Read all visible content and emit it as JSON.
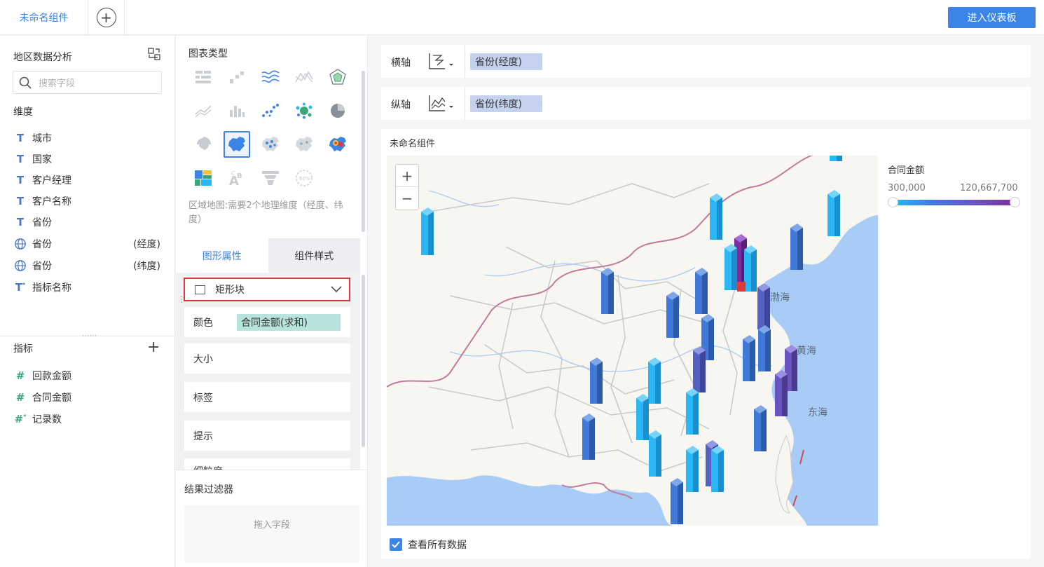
{
  "tabs": {
    "active_tab": "未命名组件",
    "add_label": "+"
  },
  "header": {
    "enter_dashboard": "进入仪表板"
  },
  "left_panel": {
    "title": "地区数据分析",
    "search_placeholder": "搜索字段",
    "dimensions_title": "维度",
    "dimensions": [
      {
        "icon": "T",
        "name": "城市",
        "suffix": ""
      },
      {
        "icon": "T",
        "name": "国家",
        "suffix": ""
      },
      {
        "icon": "T",
        "name": "客户经理",
        "suffix": ""
      },
      {
        "icon": "T",
        "name": "客户名称",
        "suffix": ""
      },
      {
        "icon": "T",
        "name": "省份",
        "suffix": ""
      },
      {
        "icon": "globe",
        "name": "省份",
        "suffix": "(经度)"
      },
      {
        "icon": "globe",
        "name": "省份",
        "suffix": "(纬度)"
      },
      {
        "icon": "T*",
        "name": "指标名称",
        "suffix": ""
      }
    ],
    "metrics_title": "指标",
    "metrics": [
      {
        "icon": "#",
        "name": "回款金额"
      },
      {
        "icon": "#",
        "name": "合同金额"
      },
      {
        "icon": "#*",
        "name": "记录数"
      }
    ]
  },
  "middle_panel": {
    "chart_type_title": "图表类型",
    "hint": "区域地图:需要2个地理维度（经度、纬度）",
    "tab_shape": "图形属性",
    "tab_style": "组件样式",
    "shape_value": "矩形块",
    "props": {
      "color": "颜色",
      "color_field": "合同金额(求和)",
      "size": "大小",
      "label": "标签",
      "tooltip": "提示",
      "partial": "细粒度"
    },
    "filter_title": "结果过滤器",
    "filter_drop": "拖入字段"
  },
  "axes": {
    "x_label": "横轴",
    "x_field": "省份(经度)",
    "y_label": "纵轴",
    "y_field": "省份(纬度)"
  },
  "canvas": {
    "title": "未命名组件",
    "zoom_in": "+",
    "zoom_out": "−",
    "legend_title": "合同金额",
    "legend_min": "300,000",
    "legend_max": "120,667,700",
    "sea_bohai": "渤海",
    "sea_huanghai": "黄海",
    "sea_donghai": "东海",
    "view_all": "查看所有数据"
  },
  "colors": {
    "accent": "#3a85e6",
    "bar_light": "#2ab7f5",
    "bar_mid": "#3f7ad9",
    "bar_purple": "#6a55c0",
    "bar_max": "#7a2fa0",
    "highlight": "#e03b3b"
  }
}
